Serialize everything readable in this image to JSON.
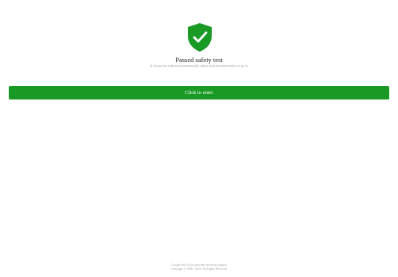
{
  "status": {
    "icon": "shield-check-icon",
    "title": "Passed safety test",
    "subtitle": "If you are not redirected automatically, please click the button below to go in"
  },
  "action": {
    "enter_label": "Click to enter"
  },
  "footer": {
    "support": "Google fails Gcted provides technical support",
    "copyright": "Copyright © 1998 - 2023. All Rights Reserved."
  },
  "colors": {
    "accent": "#1a9a24",
    "title_text": "#222222",
    "muted_text": "#9a9a9a",
    "background": "#ffffff"
  }
}
